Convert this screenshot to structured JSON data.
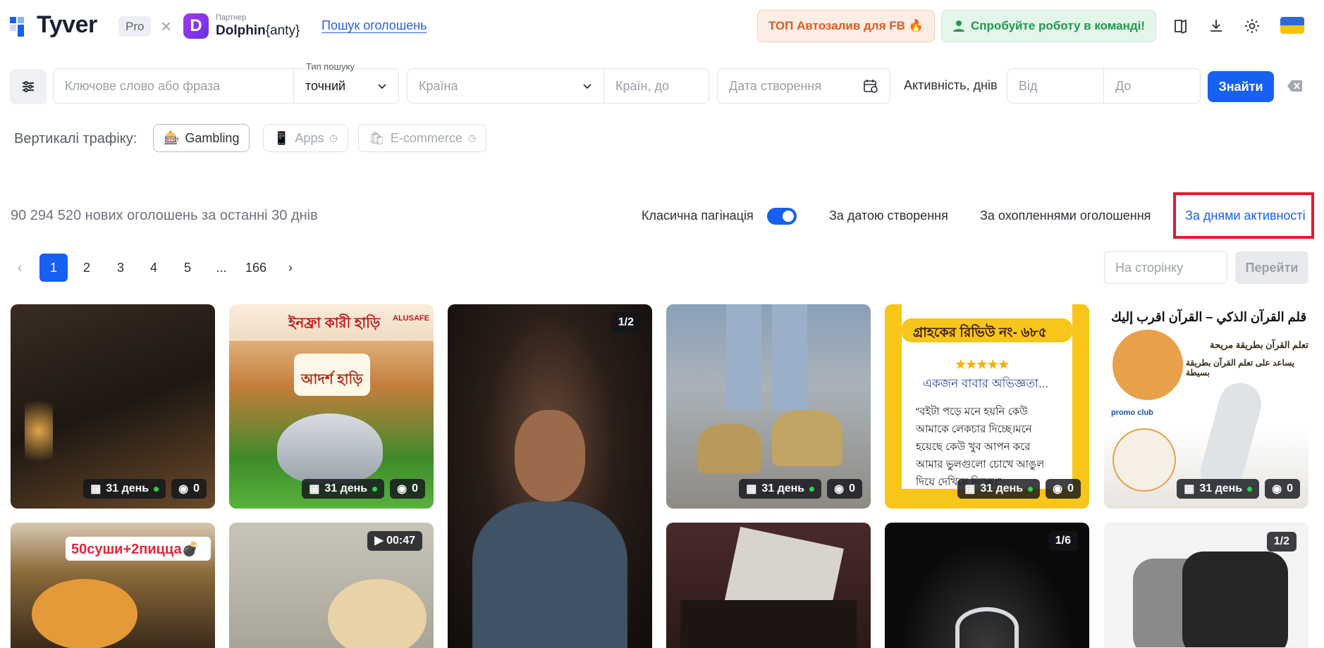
{
  "header": {
    "logo_text": "Tyver",
    "plan_badge": "Pro",
    "cross": "×",
    "partner_label": "Партнер",
    "partner_name": "Dolphin",
    "partner_suffix": "{anty}",
    "search_link": "Пошук оголошень",
    "promo_fb": "ТОП Автозалив для FB",
    "promo_team": "Спробуйте роботу в команді!",
    "icons": [
      "book-icon",
      "download-icon",
      "gear-icon"
    ],
    "flag_colors": [
      "#2f6ad8",
      "#f5c400"
    ]
  },
  "filters": {
    "keyword_placeholder": "Ключове слово або фраза",
    "search_type_label": "Тип пошуку",
    "search_type_value": "точний",
    "country_placeholder": "Країна",
    "countries_to_placeholder": "Країн, до",
    "created_date_placeholder": "Дата створення",
    "activity_label": "Активність, днів",
    "from_placeholder": "Від",
    "to_placeholder": "До",
    "find_button": "Знайти"
  },
  "verticals": {
    "label": "Вертикалі трафіку:",
    "items": [
      {
        "label": "Gambling",
        "active": true
      },
      {
        "label": "Apps",
        "active": false
      },
      {
        "label": "E-commerce",
        "active": false
      }
    ]
  },
  "results": {
    "count_text": "90 294 520 нових оголошень за останні 30 днів",
    "classic_pagination_label": "Класична пагінація",
    "classic_pagination_on": true,
    "sort_options": [
      "За датою створення",
      "За охопленнями оголошення",
      "За днями активності"
    ],
    "active_sort": "За днями активності"
  },
  "pagination": {
    "pages": [
      "1",
      "2",
      "3",
      "4",
      "5",
      "...",
      "166"
    ],
    "current": "1",
    "page_input_placeholder": "На сторінку",
    "go_button": "Перейти"
  },
  "cards": [
    {
      "days": "31 день",
      "views": "0"
    },
    {
      "days": "31 день",
      "views": "0",
      "text_top": "ইনফ্রা কারী হাড়ি",
      "brand": "ALUSAFE",
      "text_mid": "আদর্শ হাড়ি"
    },
    {
      "corner": "1/2"
    },
    {
      "days": "31 день",
      "views": "0"
    },
    {
      "days": "31 день",
      "views": "0",
      "text_top": "গ্রাহকের রিভিউ নং- ৬৮৫",
      "stars": "★★★★★",
      "text_mid": "একজন বাবার অভিজ্ঞতা...",
      "quote": "“বইটা পড়ে মনে হয়নি কেউ আমাকে লেকচার দিচ্ছে।মনে হয়েছে কেউ খুব আপন করে আমার ভুলগুলো চোখে আঙুল দিয়ে দেখিয়ে দিচ্ছে।”"
    },
    {
      "days": "31 день",
      "views": "0",
      "text_top": "قلم القرآن الذكي – القرآن اقرب إليك",
      "text_mid": "تعلم القرآن بطريقة مريحة",
      "text_mid2": "يساعد على تعلم القرآن بطريقة بسيطة",
      "brand": "promo club"
    },
    {
      "text_top": "50суши+2пицца💣"
    },
    {
      "corner": "00:47"
    },
    {},
    {
      "corner": "1/6"
    },
    {
      "corner": "1/2"
    }
  ]
}
